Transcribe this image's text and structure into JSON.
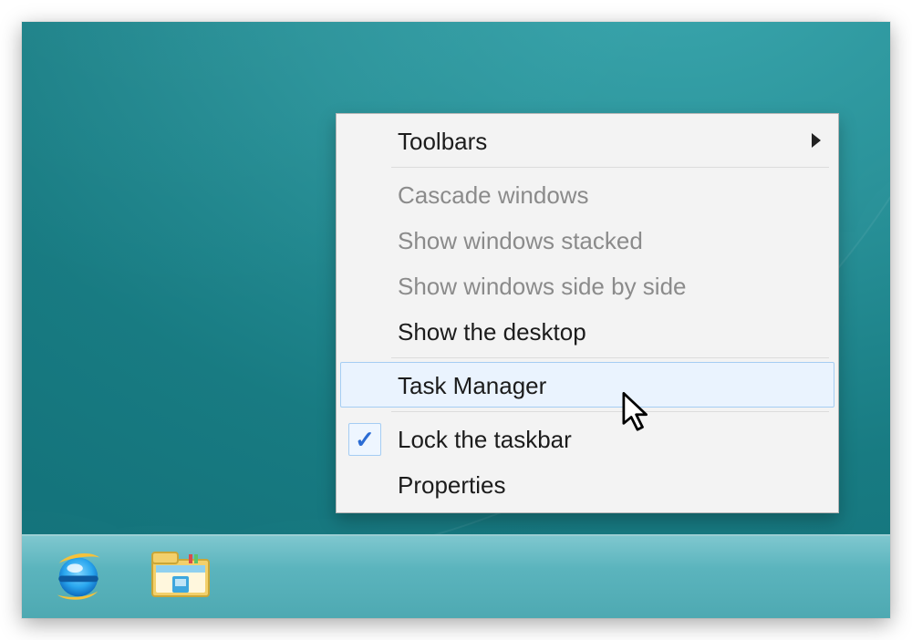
{
  "context_menu": {
    "items": [
      {
        "id": "toolbars",
        "label": "Toolbars",
        "disabled": false,
        "has_submenu": true,
        "checked": false,
        "highlight": false
      },
      {
        "sep": true
      },
      {
        "id": "cascade",
        "label": "Cascade windows",
        "disabled": true,
        "has_submenu": false,
        "checked": false,
        "highlight": false
      },
      {
        "id": "stacked",
        "label": "Show windows stacked",
        "disabled": true,
        "has_submenu": false,
        "checked": false,
        "highlight": false
      },
      {
        "id": "sidebyside",
        "label": "Show windows side by side",
        "disabled": true,
        "has_submenu": false,
        "checked": false,
        "highlight": false
      },
      {
        "id": "showdesktop",
        "label": "Show the desktop",
        "disabled": false,
        "has_submenu": false,
        "checked": false,
        "highlight": false
      },
      {
        "sep": true
      },
      {
        "id": "taskmanager",
        "label": "Task Manager",
        "disabled": false,
        "has_submenu": false,
        "checked": false,
        "highlight": true
      },
      {
        "sep": true
      },
      {
        "id": "locktaskbar",
        "label": "Lock the taskbar",
        "disabled": false,
        "has_submenu": false,
        "checked": true,
        "highlight": false
      },
      {
        "id": "properties",
        "label": "Properties",
        "disabled": false,
        "has_submenu": false,
        "checked": false,
        "highlight": false
      }
    ]
  },
  "taskbar": {
    "apps": [
      {
        "id": "ie",
        "name": "internet-explorer-icon"
      },
      {
        "id": "explorer",
        "name": "file-explorer-icon"
      }
    ]
  },
  "colors": {
    "menu_highlight_bg": "#eaf3fe",
    "menu_highlight_border": "#a5cdf3",
    "taskbar_bg": "#5bb4bd",
    "desktop_bg": "#1f858c"
  }
}
